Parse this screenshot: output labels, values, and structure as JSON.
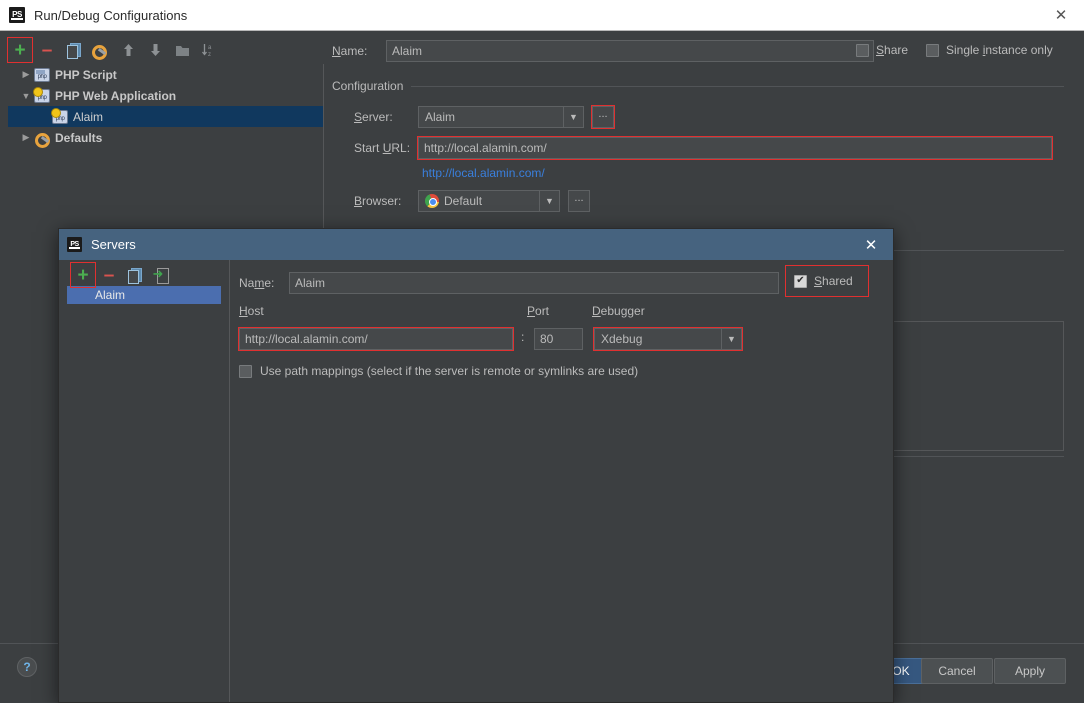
{
  "window": {
    "title": "Run/Debug Configurations",
    "logo_text": "PS",
    "close_icon": "✕"
  },
  "toolbar": {
    "items": [
      {
        "name": "add-configuration",
        "glyph": "+",
        "kind": "plus",
        "highlighted": true
      },
      {
        "name": "remove-configuration",
        "glyph": "–",
        "kind": "minus",
        "highlighted": false
      },
      {
        "name": "copy-configuration",
        "glyph": "",
        "kind": "copy",
        "highlighted": false
      },
      {
        "name": "edit-templates",
        "glyph": "",
        "kind": "wrench",
        "highlighted": false
      },
      {
        "name": "move-up",
        "glyph": "↑",
        "kind": "arrow",
        "highlighted": false
      },
      {
        "name": "move-down",
        "glyph": "↓",
        "kind": "arrow",
        "highlighted": false
      },
      {
        "name": "create-folder",
        "glyph": "",
        "kind": "folder",
        "highlighted": false
      },
      {
        "name": "sort-configurations",
        "glyph": "",
        "kind": "sort",
        "highlighted": false
      }
    ]
  },
  "tree": {
    "nodes": [
      {
        "label": "PHP Script",
        "expander": "▶",
        "icon": "php-script-icon",
        "indent": 0,
        "selected": false,
        "bold": true
      },
      {
        "label": "PHP Web Application",
        "expander": "▼",
        "icon": "php-web-icon",
        "indent": 0,
        "selected": false,
        "bold": true
      },
      {
        "label": "Alaim",
        "expander": "",
        "icon": "php-web-icon",
        "indent": 1,
        "selected": true,
        "bold": false
      },
      {
        "label": "Defaults",
        "expander": "▶",
        "icon": "wrench-icon",
        "indent": 0,
        "selected": false,
        "bold": true
      }
    ]
  },
  "config": {
    "name_label": "Name:",
    "name_value": "Alaim",
    "share_label": "Share",
    "share_checked": false,
    "single_instance_label": "Single instance only",
    "single_instance_checked": false,
    "group_title": "Configuration",
    "server_label": "Server:",
    "server_value": "Alaim",
    "server_browse": "...",
    "start_url_label": "Start URL:",
    "start_url_value": "http://local.alamin.com/",
    "start_url_link": "http://local.alamin.com/",
    "browser_label": "Browser:",
    "browser_value": "Default",
    "browser_browse": "...",
    "dropdown_arrow": "▼"
  },
  "footer": {
    "help_glyph": "?",
    "ok_label": "OK",
    "cancel_label": "Cancel",
    "apply_label": "Apply"
  },
  "servers_dialog": {
    "title": "Servers",
    "logo_text": "PS",
    "close_icon": "✕",
    "toolbar": [
      {
        "name": "add-server",
        "glyph": "+",
        "kind": "plus",
        "highlighted": true
      },
      {
        "name": "remove-server",
        "glyph": "–",
        "kind": "minus",
        "highlighted": false
      },
      {
        "name": "copy-server",
        "glyph": "",
        "kind": "copy",
        "highlighted": false
      },
      {
        "name": "import-server",
        "glyph": "",
        "kind": "import",
        "highlighted": false
      }
    ],
    "list": [
      {
        "label": "Alaim",
        "selected": true
      }
    ],
    "name_label": "Name:",
    "name_value": "Alaim",
    "shared_label": "Shared",
    "shared_checked": true,
    "host_label": "Host",
    "host_value": "http://local.alamin.com/",
    "colon": ":",
    "port_label": "Port",
    "port_value": "80",
    "debugger_label": "Debugger",
    "debugger_value": "Xdebug",
    "dropdown_arrow": "▼",
    "path_mappings_label": "Use path mappings (select if the server is remote or symlinks are used)",
    "path_mappings_checked": false
  },
  "colors": {
    "bg": "#3c3f41",
    "field_bg": "#45484a",
    "accent_blue": "#4b6eaf",
    "title_blue": "#46637f",
    "tree_selection": "#10385e",
    "link": "#3a7fdc",
    "highlight_red": "#e03030",
    "primary_button": "#365880",
    "green_plus": "#4caf50",
    "red_minus": "#d9534f"
  }
}
